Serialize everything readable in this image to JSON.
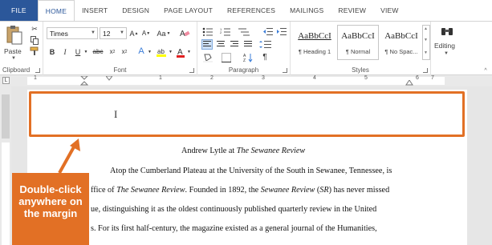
{
  "tabs": [
    "FILE",
    "HOME",
    "INSERT",
    "DESIGN",
    "PAGE LAYOUT",
    "REFERENCES",
    "MAILINGS",
    "REVIEW",
    "VIEW"
  ],
  "active_tab": "HOME",
  "clipboard": {
    "paste_label": "Paste",
    "group_label": "Clipboard"
  },
  "font": {
    "name": "Times",
    "size": "12",
    "group_label": "Font",
    "change_case": "Aa"
  },
  "paragraph": {
    "group_label": "Paragraph"
  },
  "styles": {
    "group_label": "Styles",
    "items": [
      {
        "sample": "AaBbCcI",
        "name": "¶ Heading 1"
      },
      {
        "sample": "AaBbCcI",
        "name": "¶ Normal"
      },
      {
        "sample": "AaBbCcI",
        "name": "¶ No Spac..."
      }
    ],
    "selected": "¶ Normal"
  },
  "editing": {
    "label": "Editing"
  },
  "ruler": {
    "numbers": [
      "1",
      "1",
      "2",
      "3",
      "4",
      "5",
      "6",
      "7"
    ]
  },
  "document": {
    "line1_prefix": "Andrew Lytle at ",
    "line1_italic": "The Sewanee Review",
    "line2": "Atop the Cumberland Plateau at the University of the South in Sewanee, Tennessee, is",
    "line3_a": "ffice of ",
    "line3_b": "The Sewanee Review",
    "line3_c": ". Founded in 1892, the ",
    "line3_d": "Sewanee Review",
    "line3_e": " (",
    "line3_f": "SR",
    "line3_g": ") has never missed",
    "line4": "ue, distinguishing it as the oldest continuously published quarterly review in the United",
    "line5": "s. For its first half-century, the magazine existed as a general journal of the Humanities,"
  },
  "callout": {
    "text": "Double-click anywhere on the margin"
  },
  "colors": {
    "accent": "#e27025",
    "file_tab": "#2b579a"
  }
}
